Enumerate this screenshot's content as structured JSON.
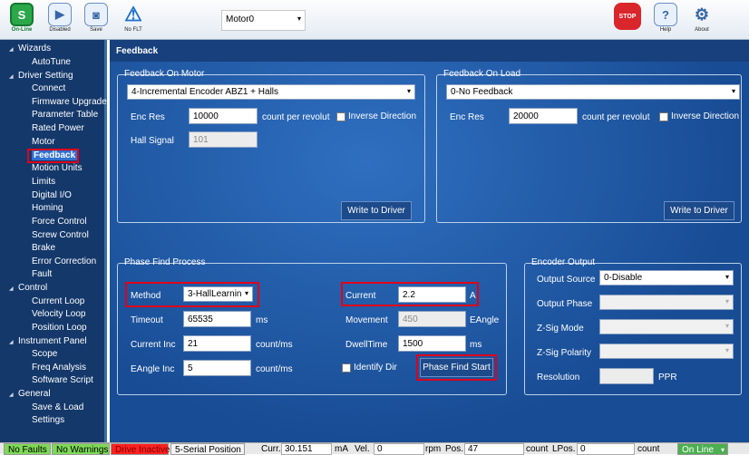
{
  "toolbar": {
    "online": "On-Line",
    "disabled": "Disabled",
    "save": "Save",
    "nofault": "No FLT",
    "motor": "Motor0",
    "stop": "STOP",
    "help": "Help",
    "about": "About"
  },
  "sidebar": {
    "wizards": "Wizards",
    "autotune": "AutoTune",
    "driver_setting": "Driver Setting",
    "connect": "Connect",
    "firmware_upgrade": "Firmware Upgrade",
    "parameter_table": "Parameter Table",
    "rated_power": "Rated Power",
    "motor": "Motor",
    "feedback": "Feedback",
    "motion_units": "Motion Units",
    "limits": "Limits",
    "digital_io": "Digital I/O",
    "homing": "Homing",
    "force_control": "Force Control",
    "screw_control": "Screw Control",
    "brake": "Brake",
    "error_correction": "Error Correction",
    "fault": "Fault",
    "control": "Control",
    "current_loop": "Current Loop",
    "velocity_loop": "Velocity Loop",
    "position_loop": "Position Loop",
    "instrument_panel": "Instrument Panel",
    "scope": "Scope",
    "freq_analysis": "Freq Analysis",
    "software_script": "Software Script",
    "general": "General",
    "save_load": "Save & Load",
    "settings": "Settings"
  },
  "main": {
    "title": "Feedback",
    "fb_motor": {
      "title": "Feedback On Motor",
      "type": "4-Incremental Encoder ABZ1 + Halls",
      "enc_res_label": "Enc Res",
      "enc_res": "10000",
      "unit": "count per revolut",
      "inverse": "Inverse Direction",
      "hall_label": "Hall Signal",
      "hall": "101",
      "write": "Write to Driver"
    },
    "fb_load": {
      "title": "Feedback On Load",
      "type": "0-No Feedback",
      "enc_res_label": "Enc Res",
      "enc_res": "20000",
      "unit": "count per revolut",
      "inverse": "Inverse Direction",
      "write": "Write to Driver"
    },
    "phase": {
      "title": "Phase Find Process",
      "method_label": "Method",
      "method": "3-HallLearnin",
      "timeout_label": "Timeout",
      "timeout": "65535",
      "timeout_unit": "ms",
      "current_inc_label": "Current Inc",
      "current_inc": "21",
      "current_inc_unit": "count/ms",
      "eangle_inc_label": "EAngle Inc",
      "eangle_inc": "5",
      "eangle_inc_unit": "count/ms",
      "current_label": "Current",
      "current": "2.2",
      "current_unit": "A",
      "movement_label": "Movement",
      "movement": "450",
      "movement_unit": "EAngle",
      "dwell_label": "DwellTime",
      "dwell": "1500",
      "dwell_unit": "ms",
      "identify": "Identify Dir",
      "start": "Phase Find Start"
    },
    "encoder_out": {
      "title": "Encoder Output",
      "source_label": "Output Source",
      "source": "0-Disable",
      "phase_label": "Output Phase",
      "zsig_mode_label": "Z-Sig Mode",
      "zsig_pol_label": "Z-Sig Polarity",
      "res_label": "Resolution",
      "res_unit": "PPR"
    }
  },
  "status": {
    "no_faults": "No Faults",
    "no_warnings": "No Warnings",
    "drive": "Drive Inactive",
    "mode": "5-Serial Position",
    "curr_label": "Curr.",
    "curr": "30.151",
    "curr_unit": "mA",
    "vel_label": "Vel.",
    "vel": "0",
    "vel_unit": "rpm",
    "pos_label": "Pos.",
    "pos": "47",
    "pos_unit": "count",
    "lpos_label": "LPos.",
    "lpos": "0",
    "lpos_unit": "count",
    "online": "On Line"
  },
  "colors": {
    "sidebar_bg": "#14386a",
    "main_bg": "#2f6fc0",
    "highlight": "#e0001b",
    "status_green": "#7ed957",
    "status_red": "#ff2020",
    "online_green": "#4caf50"
  }
}
